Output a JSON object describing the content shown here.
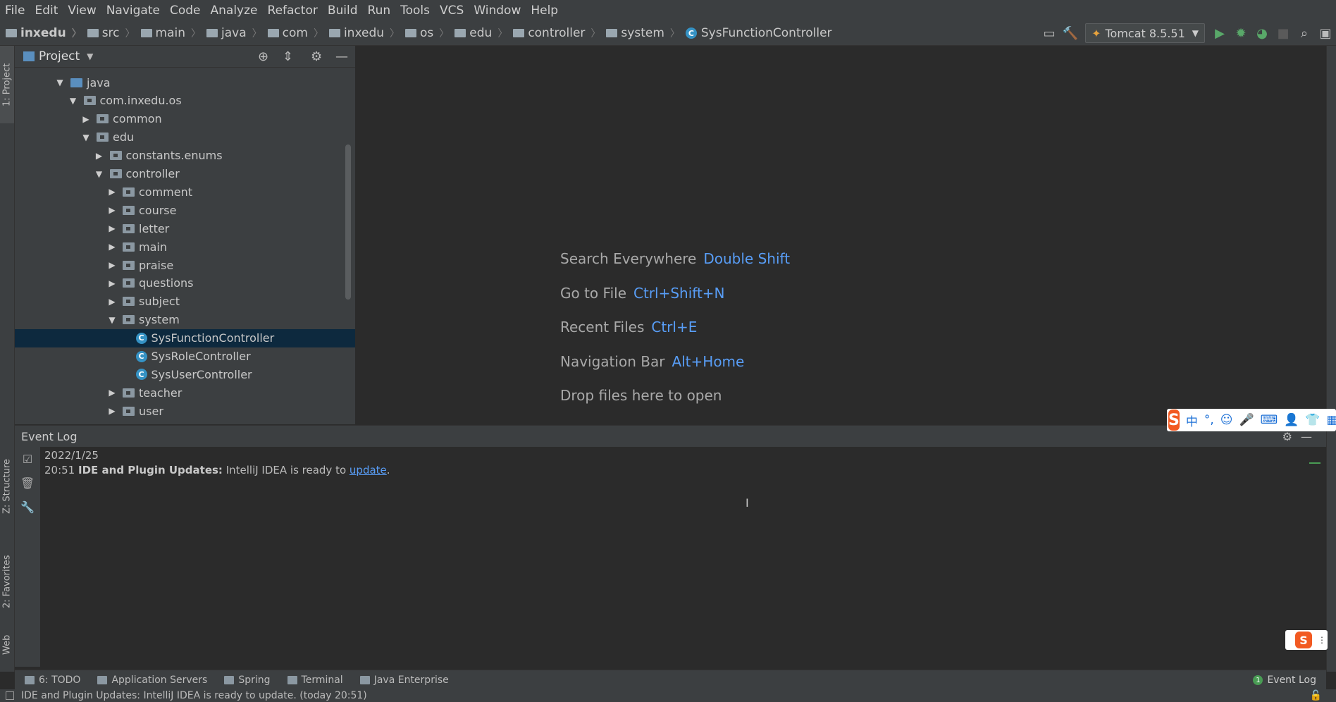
{
  "menu": [
    "File",
    "Edit",
    "View",
    "Navigate",
    "Code",
    "Analyze",
    "Refactor",
    "Build",
    "Run",
    "Tools",
    "VCS",
    "Window",
    "Help"
  ],
  "breadcrumb": [
    "inxedu",
    "src",
    "main",
    "java",
    "com",
    "inxedu",
    "os",
    "edu",
    "controller",
    "system",
    "SysFunctionController"
  ],
  "run_config": "Tomcat 8.5.51",
  "left_stripe": {
    "project": "1: Project",
    "structure": "Z: Structure",
    "favorites": "2: Favorites",
    "web": "Web"
  },
  "project": {
    "title": "Project",
    "tree": [
      {
        "label": "java",
        "depth": 0,
        "arrow": "▼",
        "kind": "blue"
      },
      {
        "label": "com.inxedu.os",
        "depth": 1,
        "arrow": "▼",
        "kind": "pkg"
      },
      {
        "label": "common",
        "depth": 2,
        "arrow": "▶",
        "kind": "pkg"
      },
      {
        "label": "edu",
        "depth": 2,
        "arrow": "▼",
        "kind": "pkg"
      },
      {
        "label": "constants.enums",
        "depth": 3,
        "arrow": "▶",
        "kind": "pkg"
      },
      {
        "label": "controller",
        "depth": 3,
        "arrow": "▼",
        "kind": "pkg"
      },
      {
        "label": "comment",
        "depth": 4,
        "arrow": "▶",
        "kind": "pkg"
      },
      {
        "label": "course",
        "depth": 4,
        "arrow": "▶",
        "kind": "pkg"
      },
      {
        "label": "letter",
        "depth": 4,
        "arrow": "▶",
        "kind": "pkg"
      },
      {
        "label": "main",
        "depth": 4,
        "arrow": "▶",
        "kind": "pkg"
      },
      {
        "label": "praise",
        "depth": 4,
        "arrow": "▶",
        "kind": "pkg"
      },
      {
        "label": "questions",
        "depth": 4,
        "arrow": "▶",
        "kind": "pkg"
      },
      {
        "label": "subject",
        "depth": 4,
        "arrow": "▶",
        "kind": "pkg"
      },
      {
        "label": "system",
        "depth": 4,
        "arrow": "▼",
        "kind": "pkg"
      },
      {
        "label": "SysFunctionController",
        "depth": 5,
        "arrow": "",
        "kind": "class",
        "selected": true
      },
      {
        "label": "SysRoleController",
        "depth": 5,
        "arrow": "",
        "kind": "class"
      },
      {
        "label": "SysUserController",
        "depth": 5,
        "arrow": "",
        "kind": "class"
      },
      {
        "label": "teacher",
        "depth": 4,
        "arrow": "▶",
        "kind": "pkg"
      },
      {
        "label": "user",
        "depth": 4,
        "arrow": "▶",
        "kind": "pkg"
      }
    ]
  },
  "editor": {
    "hints": [
      {
        "label": "Search Everywhere",
        "key": "Double Shift"
      },
      {
        "label": "Go to File",
        "key": "Ctrl+Shift+N"
      },
      {
        "label": "Recent Files",
        "key": "Ctrl+E"
      },
      {
        "label": "Navigation Bar",
        "key": "Alt+Home"
      },
      {
        "label": "Drop files here to open",
        "key": ""
      }
    ]
  },
  "event_log": {
    "title": "Event Log",
    "date": "2022/1/25",
    "time": "20:51",
    "bold": "IDE and Plugin Updates:",
    "text": " IntelliJ IDEA is ready to ",
    "link": "update",
    "end": "."
  },
  "bottom_tabs": [
    "6: TODO",
    "Application Servers",
    "Spring",
    "Terminal",
    "Java Enterprise"
  ],
  "event_log_tab": {
    "badge": "1",
    "label": "Event Log"
  },
  "status": "IDE and Plugin Updates: IntelliJ IDEA is ready to update. (today 20:51)",
  "ime": {
    "logo": "S",
    "items": [
      "中",
      "°,",
      "☺",
      "🎤",
      "⌨",
      "👤",
      "👕",
      "▦"
    ]
  }
}
